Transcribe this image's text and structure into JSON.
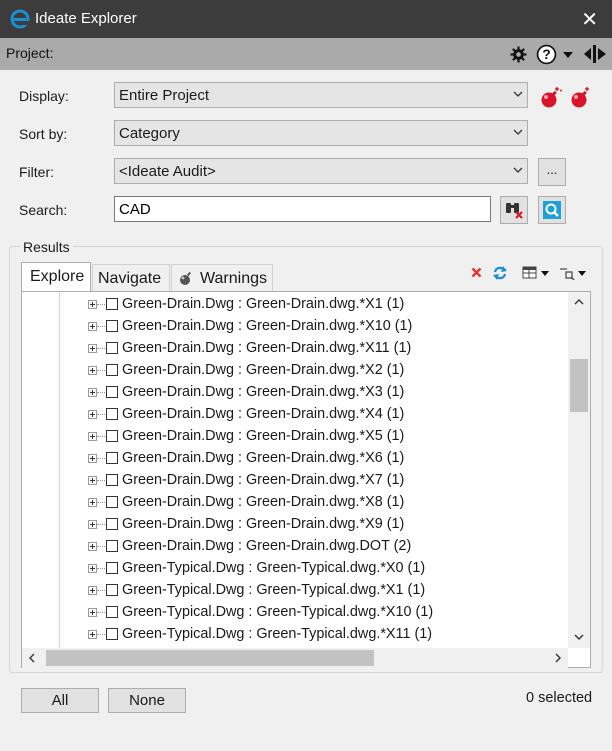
{
  "window": {
    "title": "Ideate Explorer",
    "close_glyph": "✕"
  },
  "project_bar": {
    "label": "Project:",
    "icons": [
      "gear-icon",
      "help-icon",
      "dropdown-icon",
      "pin-panel-icon"
    ]
  },
  "form": {
    "display": {
      "label": "Display:",
      "value": "Entire Project"
    },
    "sort_by": {
      "label": "Sort by:",
      "value": "Category"
    },
    "filter": {
      "label": "Filter:",
      "value": "<Ideate Audit>",
      "browse_label": "..."
    },
    "search": {
      "label": "Search:",
      "value": "CAD"
    }
  },
  "results": {
    "group_label": "Results",
    "tabs": [
      {
        "label": "Explore",
        "active": true
      },
      {
        "label": "Navigate",
        "active": false
      },
      {
        "label": "Warnings",
        "active": false
      }
    ],
    "items": [
      "Green-Drain.Dwg : Green-Drain.dwg.*X1 (1)",
      "Green-Drain.Dwg : Green-Drain.dwg.*X10 (1)",
      "Green-Drain.Dwg : Green-Drain.dwg.*X11 (1)",
      "Green-Drain.Dwg : Green-Drain.dwg.*X2 (1)",
      "Green-Drain.Dwg : Green-Drain.dwg.*X3 (1)",
      "Green-Drain.Dwg : Green-Drain.dwg.*X4 (1)",
      "Green-Drain.Dwg : Green-Drain.dwg.*X5 (1)",
      "Green-Drain.Dwg : Green-Drain.dwg.*X6 (1)",
      "Green-Drain.Dwg : Green-Drain.dwg.*X7 (1)",
      "Green-Drain.Dwg : Green-Drain.dwg.*X8 (1)",
      "Green-Drain.Dwg : Green-Drain.dwg.*X9 (1)",
      "Green-Drain.Dwg : Green-Drain.dwg.DOT (2)",
      "Green-Typical.Dwg : Green-Typical.dwg.*X0 (1)",
      "Green-Typical.Dwg : Green-Typical.dwg.*X1 (1)",
      "Green-Typical.Dwg : Green-Typical.dwg.*X10 (1)",
      "Green-Typical.Dwg : Green-Typical.dwg.*X11 (1)"
    ]
  },
  "footer": {
    "all_label": "All",
    "none_label": "None",
    "selected_text": "0 selected"
  },
  "colors": {
    "titlebar": "#3c3c3c",
    "project_bar": "#aaaaaa",
    "accent": "#1b8fd1",
    "bomb": "#d8132a"
  }
}
